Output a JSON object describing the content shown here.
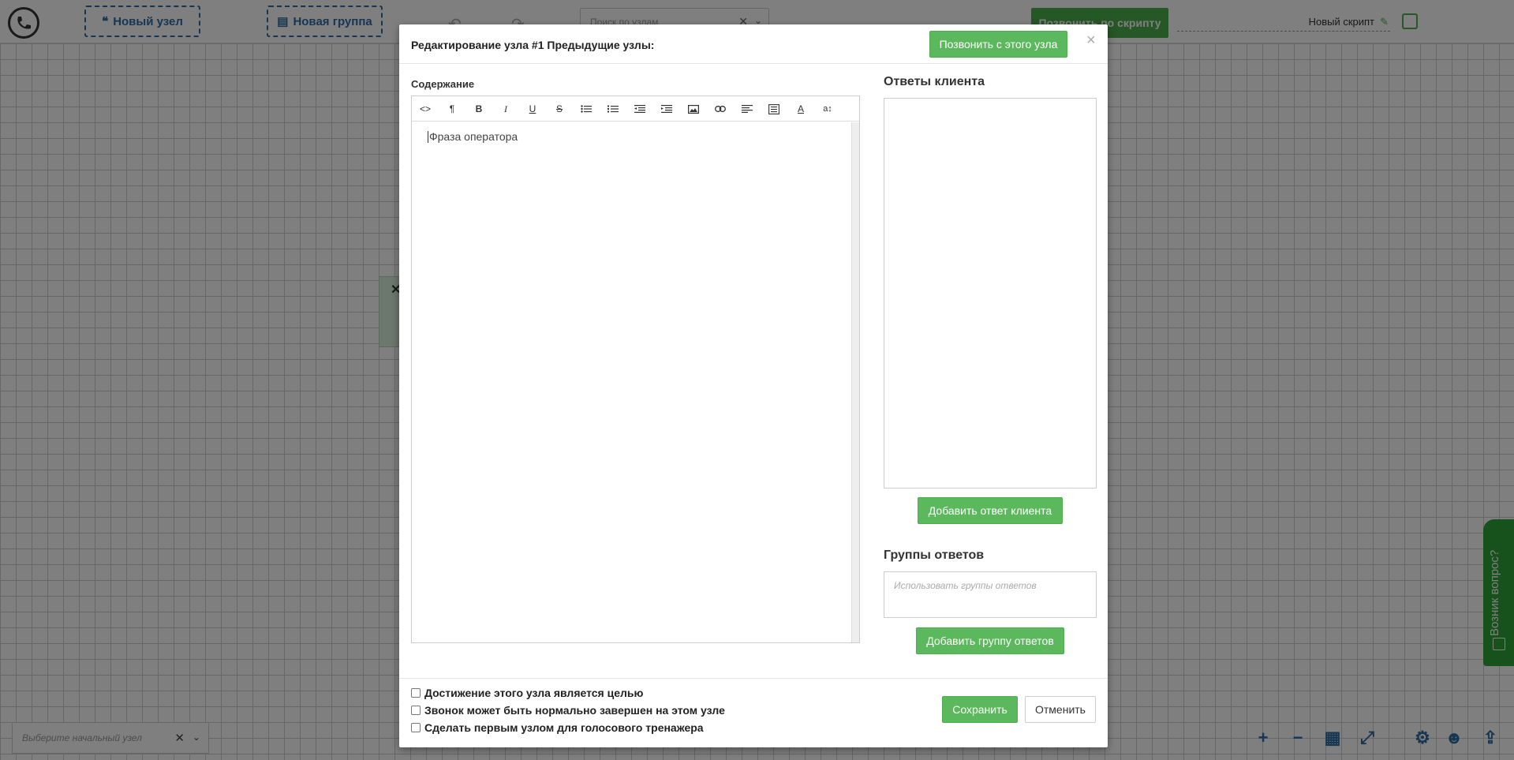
{
  "topbar": {
    "new_node_label": "Новый узел",
    "new_group_label": "Новая группа",
    "search_placeholder": "Поиск по узлам",
    "call_script_label": "Позвонить по скрипту",
    "script_name": "Новый скрипт"
  },
  "bottom": {
    "start_node_placeholder": "Выберите начальный узел"
  },
  "help_tab": {
    "label": "Возник вопрос?"
  },
  "modal": {
    "title": "Редактирование узла #1 Предыдущие узлы:",
    "call_from_node_label": "Позвонить с этого узла",
    "content_label": "Содержание",
    "editor_text": "Фраза оператора",
    "toolbar_icons": [
      "code-view-icon",
      "paragraph-icon",
      "bold-icon",
      "italic-icon",
      "underline-icon",
      "strikethrough-icon",
      "unordered-list-icon",
      "ordered-list-icon",
      "outdent-icon",
      "indent-icon",
      "image-icon",
      "link-icon",
      "align-left-icon",
      "align-justify-icon",
      "font-color-icon",
      "font-size-icon"
    ],
    "answers_heading": "Ответы клиента",
    "add_answer_label": "Добавить ответ клиента",
    "groups_heading": "Группы ответов",
    "groups_placeholder": "Использовать группы ответов",
    "add_group_label": "Добавить группу ответов",
    "checkboxes": [
      "Достижение этого узла является целью",
      "Звонок может быть нормально завершен на этом узле",
      "Сделать первым узлом для голосового тренажера"
    ],
    "save_label": "Сохранить",
    "cancel_label": "Отменить"
  },
  "colors": {
    "accent_green": "#5cb85c",
    "accent_blue": "#2e6da4"
  }
}
